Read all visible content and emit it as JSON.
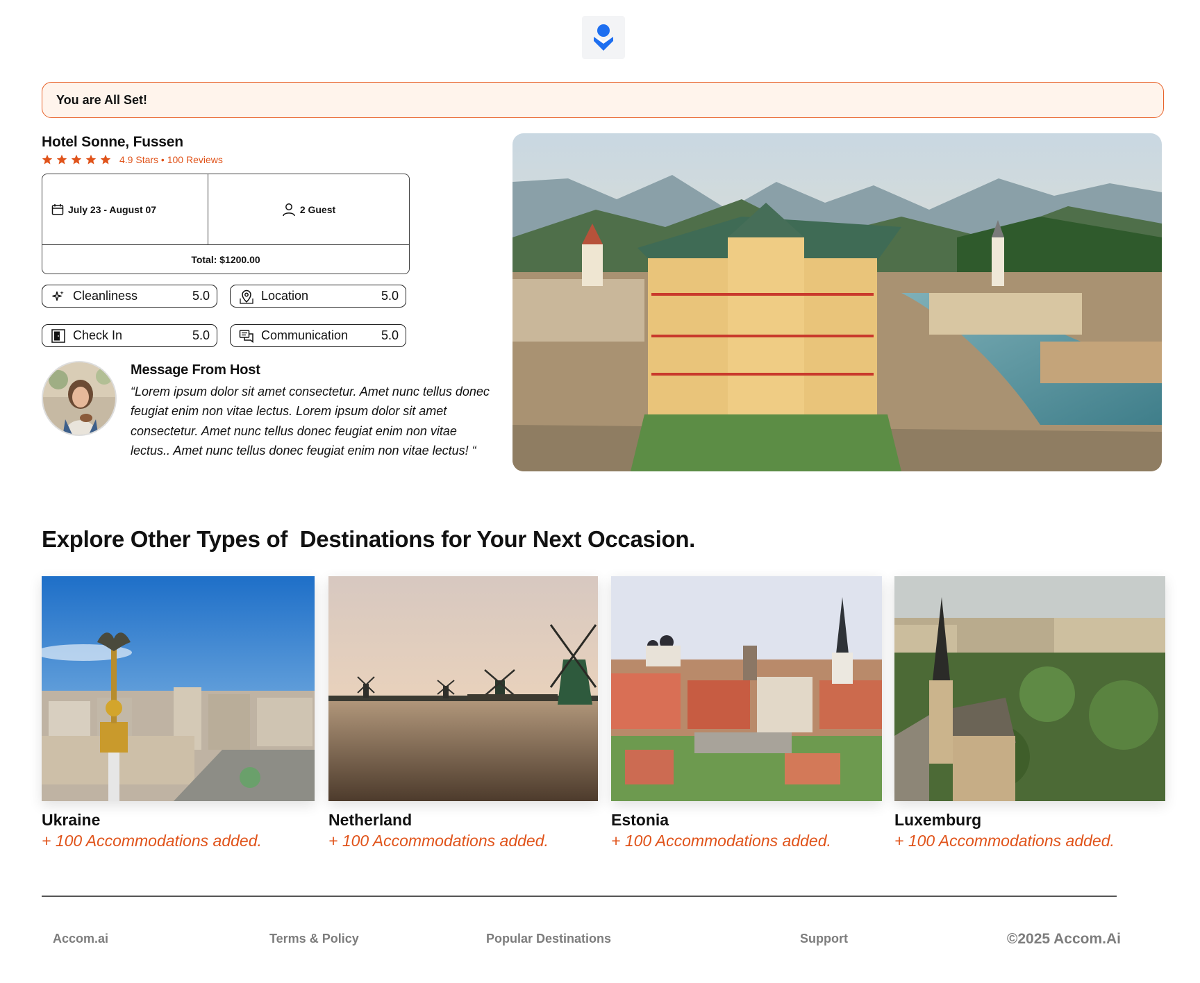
{
  "brand": {
    "logo_icon": "pin-person-icon",
    "accent": "#1e6ff0"
  },
  "banner": {
    "text": "You are All Set!",
    "border_color": "#e8642c",
    "bg_color": "#fff4ec"
  },
  "hotel": {
    "name": "Hotel Sonne, Fussen",
    "stars": 5,
    "rating_text": "4.9 Stars • 100 Reviews",
    "star_color": "#e0531a"
  },
  "booking": {
    "dates": "July 23 - August 07",
    "guests": "2 Guest",
    "total": "Total: $1200.00"
  },
  "scores": [
    {
      "label": "Cleanliness",
      "value": "5.0",
      "icon": "sparkle-icon"
    },
    {
      "label": "Location",
      "value": "5.0",
      "icon": "map-pin-icon"
    },
    {
      "label": "Check In",
      "value": "5.0",
      "icon": "door-icon"
    },
    {
      "label": "Communication",
      "value": "5.0",
      "icon": "chat-icon"
    }
  ],
  "host": {
    "title": "Message From Host",
    "message": "“Lorem ipsum dolor sit amet consectetur. Amet nunc tellus donec feugiat enim non vitae lectus. Lorem ipsum dolor sit amet consectetur. Amet nunc tellus donec feugiat enim non vitae lectus.. Amet nunc tellus donec feugiat enim non vitae lectus! “"
  },
  "explore": {
    "title": "Explore Other Types of  Destinations for Your Next Occasion.",
    "destinations": [
      {
        "name": "Ukraine",
        "subtitle": "+ 100 Accommodations added."
      },
      {
        "name": "Netherland",
        "subtitle": "+ 100 Accommodations added."
      },
      {
        "name": "Estonia",
        "subtitle": "+ 100 Accommodations added."
      },
      {
        "name": "Luxemburg",
        "subtitle": "+ 100 Accommodations added."
      }
    ]
  },
  "footer": {
    "links": [
      "Accom.ai",
      "Terms & Policy",
      "Popular Destinations",
      "Support"
    ],
    "copyright": "©2025 Accom.Ai"
  }
}
